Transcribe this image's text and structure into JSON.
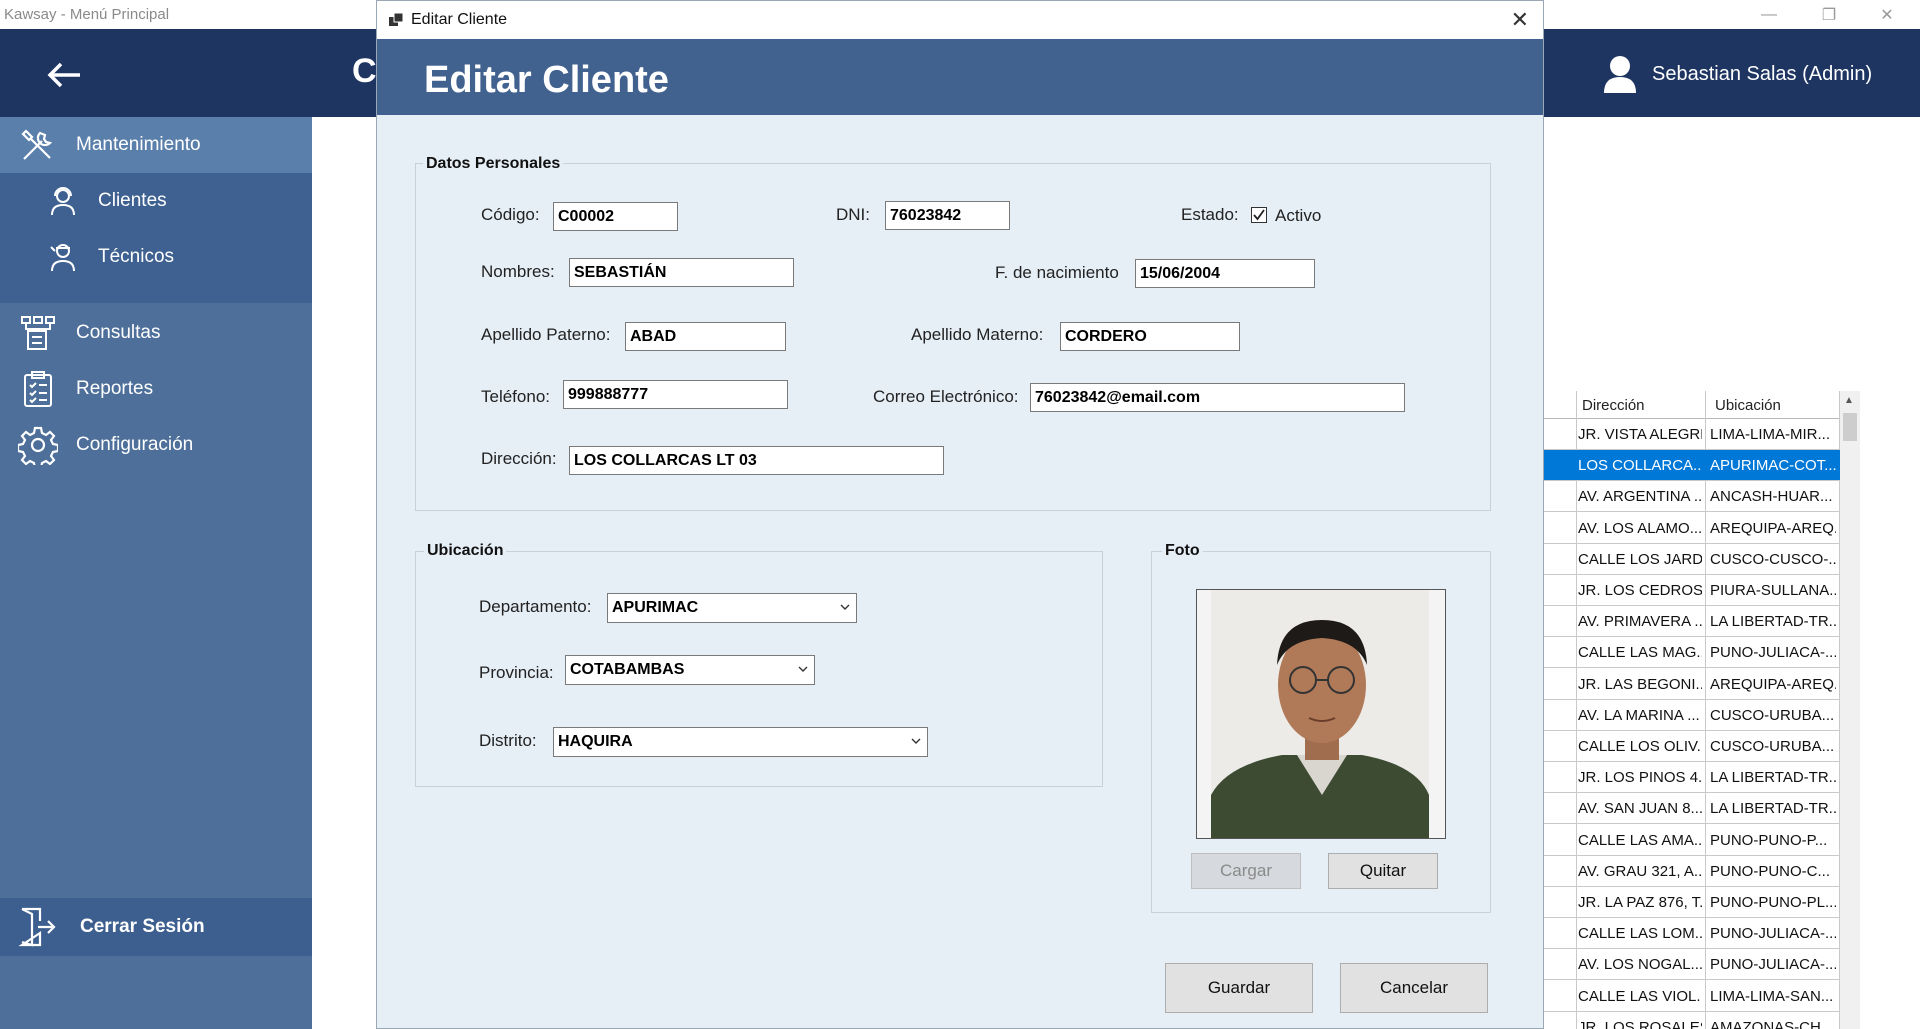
{
  "window": {
    "title": "Kawsay - Menú Principal",
    "controls": {
      "minimize": "—",
      "restore": "❐",
      "close": "✕"
    }
  },
  "header": {
    "back_icon": "arrow-left-icon",
    "title_initial": "C",
    "user_name": "Sebastian Salas (Admin)"
  },
  "sidebar": {
    "mantenimiento": "Mantenimiento",
    "clientes": "Clientes",
    "tecnicos": "Técnicos",
    "consultas": "Consultas",
    "reportes": "Reportes",
    "configuracion": "Configuración",
    "logout": "Cerrar Sesión"
  },
  "grid": {
    "columns": [
      "Dirección",
      "Ubicación"
    ],
    "rows": [
      {
        "direccion": "JR. VISTA ALEGRE",
        "ubicacion": "LIMA-LIMA-MIR..."
      },
      {
        "direccion": "LOS COLLARCA...",
        "ubicacion": "APURIMAC-COT...",
        "selected": true
      },
      {
        "direccion": "AV. ARGENTINA ...",
        "ubicacion": "ANCASH-HUAR..."
      },
      {
        "direccion": "AV. LOS ALAMO...",
        "ubicacion": "AREQUIPA-AREQ..."
      },
      {
        "direccion": "CALLE LOS JARD...",
        "ubicacion": "CUSCO-CUSCO-..."
      },
      {
        "direccion": "JR. LOS CEDROS ...",
        "ubicacion": "PIURA-SULLANA..."
      },
      {
        "direccion": "AV. PRIMAVERA ...",
        "ubicacion": "LA LIBERTAD-TR..."
      },
      {
        "direccion": "CALLE LAS MAG...",
        "ubicacion": "PUNO-JULIACA-..."
      },
      {
        "direccion": "JR. LAS BEGONI...",
        "ubicacion": "AREQUIPA-AREQ..."
      },
      {
        "direccion": "AV. LA MARINA ...",
        "ubicacion": "CUSCO-URUBA..."
      },
      {
        "direccion": "CALLE LOS OLIV...",
        "ubicacion": "CUSCO-URUBA..."
      },
      {
        "direccion": "JR. LOS PINOS 4...",
        "ubicacion": "LA LIBERTAD-TR..."
      },
      {
        "direccion": "AV. SAN JUAN 8...",
        "ubicacion": "LA LIBERTAD-TR..."
      },
      {
        "direccion": "CALLE LAS AMA...",
        "ubicacion": "PUNO-PUNO-P..."
      },
      {
        "direccion": "AV. GRAU 321, A...",
        "ubicacion": "PUNO-PUNO-C..."
      },
      {
        "direccion": "JR. LA PAZ 876, T...",
        "ubicacion": "PUNO-PUNO-PL..."
      },
      {
        "direccion": "CALLE LAS LOM...",
        "ubicacion": "PUNO-JULIACA-..."
      },
      {
        "direccion": "AV. LOS NOGAL...",
        "ubicacion": "PUNO-JULIACA-..."
      },
      {
        "direccion": "CALLE LAS VIOL...",
        "ubicacion": "LIMA-LIMA-SAN..."
      },
      {
        "direccion": "JR. LOS ROSALES ...",
        "ubicacion": "AMAZONAS-CH..."
      }
    ]
  },
  "dialog": {
    "window_title": "Editar Cliente",
    "close_glyph": "✕",
    "banner_title": "Editar Cliente",
    "personal": {
      "group_label": "Datos Personales",
      "codigo_label": "Código:",
      "codigo_value": "C00002",
      "dni_label": "DNI:",
      "dni_value": "76023842",
      "estado_label": "Estado:",
      "activo_label": "Activo",
      "activo_checked": true,
      "nombres_label": "Nombres:",
      "nombres_value": "SEBASTIÁN",
      "nacimiento_label": "F. de nacimiento",
      "nacimiento_value": "15/06/2004",
      "paterno_label": "Apellido Paterno:",
      "paterno_value": "ABAD",
      "materno_label": "Apellido Materno:",
      "materno_value": "CORDERO",
      "telefono_label": "Teléfono:",
      "telefono_value": "999888777",
      "correo_label": "Correo Electrónico:",
      "correo_value": "76023842@email.com",
      "direccion_label": "Dirección:",
      "direccion_value": "LOS COLLARCAS LT 03"
    },
    "ubicacion": {
      "group_label": "Ubicación",
      "departamento_label": "Departamento:",
      "departamento_value": "APURIMAC",
      "provincia_label": "Provincia:",
      "provincia_value": "COTABAMBAS",
      "distrito_label": "Distrito:",
      "distrito_value": "HAQUIRA"
    },
    "foto": {
      "group_label": "Foto",
      "cargar_label": "Cargar",
      "quitar_label": "Quitar"
    },
    "guardar_label": "Guardar",
    "cancelar_label": "Cancelar"
  },
  "colors": {
    "header": "#1e3562",
    "sidebar": "#4d6f99",
    "dialog_banner": "#41618f",
    "dialog_body": "#e6eef6",
    "selection": "#0078d7"
  }
}
